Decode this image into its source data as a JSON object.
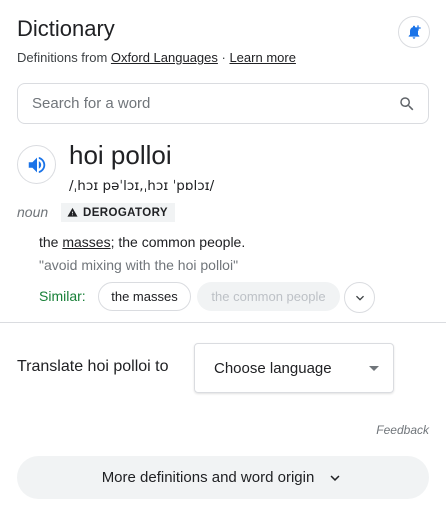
{
  "header": {
    "title": "Dictionary",
    "subtitle_prefix": "Definitions from ",
    "source_link": "Oxford Languages",
    "separator": " · ",
    "learn_more": "Learn more"
  },
  "search": {
    "placeholder": "Search for a word",
    "value": ""
  },
  "entry": {
    "word": "hoi polloi",
    "phonetic": "/ˌhɔɪ pəˈlɔɪ,ˌhɔɪ ˈpɒlɔɪ/",
    "part_of_speech": "noun",
    "label": "DEROGATORY",
    "definition_prefix": "the ",
    "definition_link": "masses",
    "definition_suffix": "; the common people.",
    "example": "\"avoid mixing with the hoi polloi\"",
    "similar_label": "Similar:",
    "similar": [
      "the masses",
      "the common people"
    ]
  },
  "translate": {
    "label": "Translate hoi polloi to",
    "select_value": "Choose language"
  },
  "feedback": "Feedback",
  "more_button": "More definitions and word origin",
  "colors": {
    "accent_blue": "#1a73e8",
    "similar_green": "#188038",
    "border": "#dadce0",
    "chip_bg": "#f1f3f4"
  }
}
